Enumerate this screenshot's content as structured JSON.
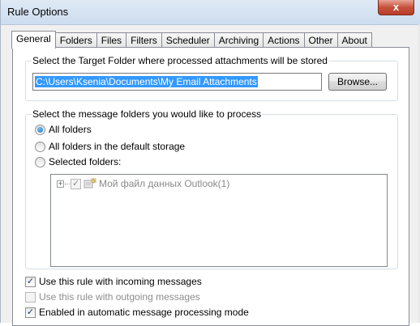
{
  "window": {
    "title": "Rule Options",
    "close_glyph": "x"
  },
  "tabs": [
    {
      "label": "General",
      "active": true
    },
    {
      "label": "Folders",
      "active": false
    },
    {
      "label": "Files",
      "active": false
    },
    {
      "label": "Filters",
      "active": false
    },
    {
      "label": "Scheduler",
      "active": false
    },
    {
      "label": "Archiving",
      "active": false
    },
    {
      "label": "Actions",
      "active": false
    },
    {
      "label": "Other",
      "active": false
    },
    {
      "label": "About",
      "active": false
    }
  ],
  "target_folder": {
    "caption": "Select the Target Folder where processed attachments will be stored",
    "path": "C:\\Users\\Ksenia\\Documents\\My Email Attachments",
    "browse_label": "Browse..."
  },
  "message_folders": {
    "caption": "Select the message folders you would like to process",
    "options": [
      {
        "label": "All folders",
        "selected": true
      },
      {
        "label": "All folders in the default storage",
        "selected": false
      },
      {
        "label": "Selected folders:",
        "selected": false
      }
    ],
    "tree": {
      "expander": "+",
      "check_glyph": "✓",
      "icon": "outlook-data-file-icon",
      "label": "Мой файл данных Outlook(1)"
    }
  },
  "options": [
    {
      "label": "Use this rule with incoming messages",
      "checked": true,
      "enabled": true
    },
    {
      "label": "Use this rule with outgoing messages",
      "checked": false,
      "enabled": false
    },
    {
      "label": "Enabled in automatic message processing mode",
      "checked": true,
      "enabled": true
    }
  ],
  "colors": {
    "selection": "#3399ff",
    "radio_fill": "#1b6fc0",
    "disabled_text": "#8d8d8d"
  }
}
